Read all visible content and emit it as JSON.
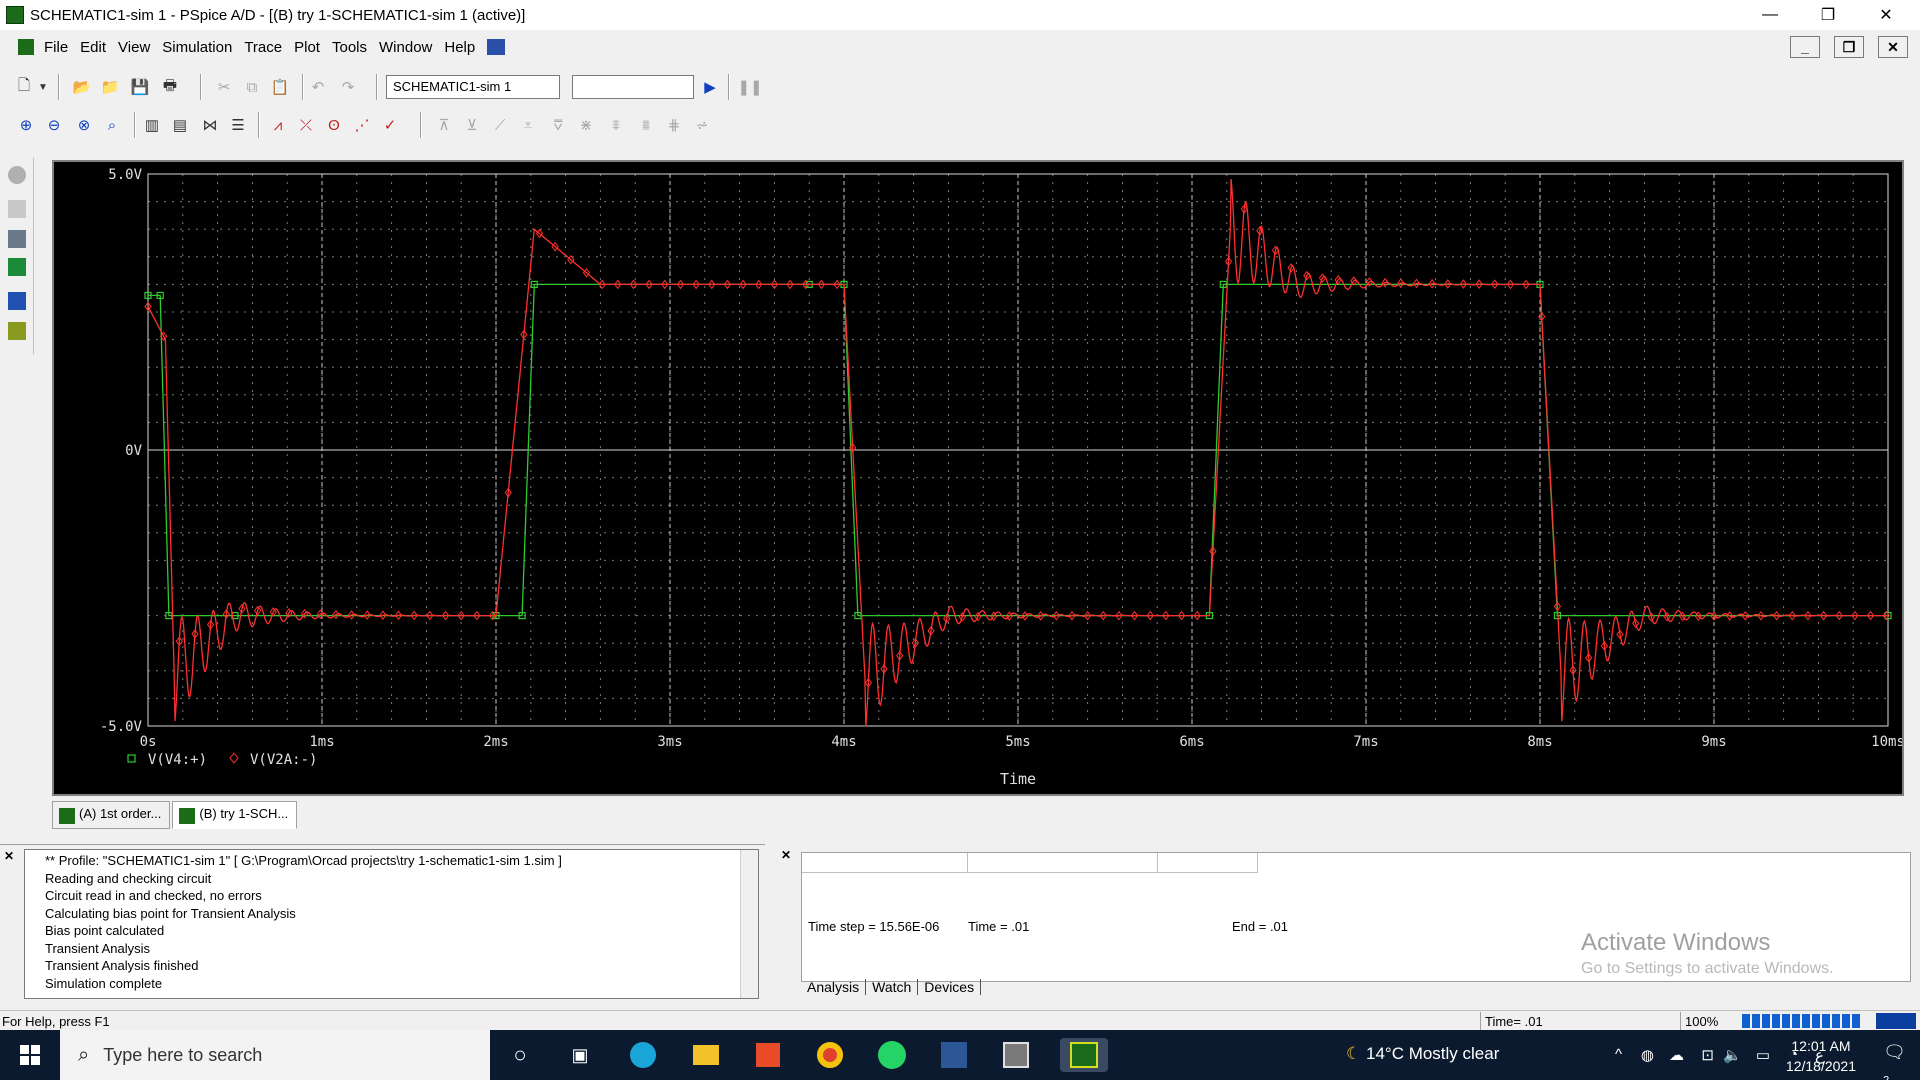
{
  "window": {
    "title": "SCHEMATIC1-sim 1 - PSpice A/D  - [(B) try 1-SCHEMATIC1-sim 1 (active)]",
    "minimize": "—",
    "restore": "❐",
    "close": "✕"
  },
  "menu": {
    "items": [
      "File",
      "Edit",
      "View",
      "Simulation",
      "Trace",
      "Plot",
      "Tools",
      "Window",
      "Help"
    ],
    "doc_minimize": "_",
    "doc_restore": "❐",
    "doc_close": "✕"
  },
  "toolbar": {
    "profile_value": "SCHEMATIC1-sim 1",
    "second_value": ""
  },
  "chart_data": {
    "type": "line",
    "xlabel": "Time",
    "x_ticks": [
      "0s",
      "1ms",
      "2ms",
      "3ms",
      "4ms",
      "5ms",
      "6ms",
      "7ms",
      "8ms",
      "9ms",
      "10ms"
    ],
    "y_ticks": [
      "5.0V",
      "0V",
      "-5.0V"
    ],
    "xlim_ms": [
      0,
      10
    ],
    "ylim_v": [
      -5.0,
      5.0
    ],
    "grid": true,
    "legend_placement": "bottom-left",
    "background": "#000000",
    "series": [
      {
        "name": "V(V4:+)",
        "color": "#2ecc2e",
        "marker": "square",
        "points_ms_v": [
          [
            0,
            2.8
          ],
          [
            0.07,
            2.8
          ],
          [
            0.12,
            -3.0
          ],
          [
            0.5,
            -3.0
          ],
          [
            2.0,
            -3.0
          ],
          [
            2.15,
            -3.0
          ],
          [
            2.22,
            3.0
          ],
          [
            3.8,
            3.0
          ],
          [
            4.0,
            3.0
          ],
          [
            4.08,
            -3.0
          ],
          [
            6.1,
            -3.0
          ],
          [
            6.18,
            3.0
          ],
          [
            8.0,
            3.0
          ],
          [
            8.1,
            -3.0
          ],
          [
            10.0,
            -3.0
          ]
        ]
      },
      {
        "name": "V(V2A:-)",
        "color": "#ff3030",
        "marker": "diamond",
        "ringing": true,
        "peak_overshoot_v": 4.0,
        "points_ms_v": [
          [
            0,
            2.6
          ],
          [
            0.1,
            2.0
          ],
          [
            0.15,
            -4.0
          ],
          [
            0.5,
            -3.0
          ],
          [
            2.0,
            -3.0
          ],
          [
            2.22,
            4.0
          ],
          [
            2.6,
            3.0
          ],
          [
            4.0,
            3.0
          ],
          [
            4.12,
            -4.1
          ],
          [
            4.6,
            -3.0
          ],
          [
            6.1,
            -3.0
          ],
          [
            6.22,
            4.0
          ],
          [
            6.6,
            3.0
          ],
          [
            8.0,
            3.0
          ],
          [
            8.12,
            -4.0
          ],
          [
            8.6,
            -3.0
          ],
          [
            10.0,
            -3.0
          ]
        ]
      }
    ]
  },
  "window_tabs": [
    {
      "label": "(A) 1st order..."
    },
    {
      "label": "(B) try 1-SCH..."
    }
  ],
  "output_log": [
    "** Profile: \"SCHEMATIC1-sim 1\"  [ G:\\Program\\Orcad projects\\try 1-schematic1-sim 1.sim ]",
    "Reading and checking circuit",
    "Circuit read in and checked, no errors",
    "Calculating bias point for Transient Analysis",
    "Bias point calculated",
    "Transient Analysis",
    "Transient Analysis finished",
    "Simulation complete"
  ],
  "sim_status": {
    "time_step": "Time step =  15.56E-06",
    "time": "Time =  .01",
    "end": "End =  .01",
    "tabs": [
      "Analysis",
      "Watch",
      "Devices"
    ]
  },
  "watermark": {
    "line1": "Activate Windows",
    "line2": "Go to Settings to activate Windows."
  },
  "statusbar": {
    "help": "For Help, press F1",
    "time": "Time= .01",
    "zoom": "100%",
    "progress_fraction": 1.0
  },
  "taskbar": {
    "search_placeholder": "Type here to search",
    "weather": "14°C  Mostly clear",
    "time": "12:01 AM",
    "date": "12/18/2021",
    "notifications": "2"
  }
}
